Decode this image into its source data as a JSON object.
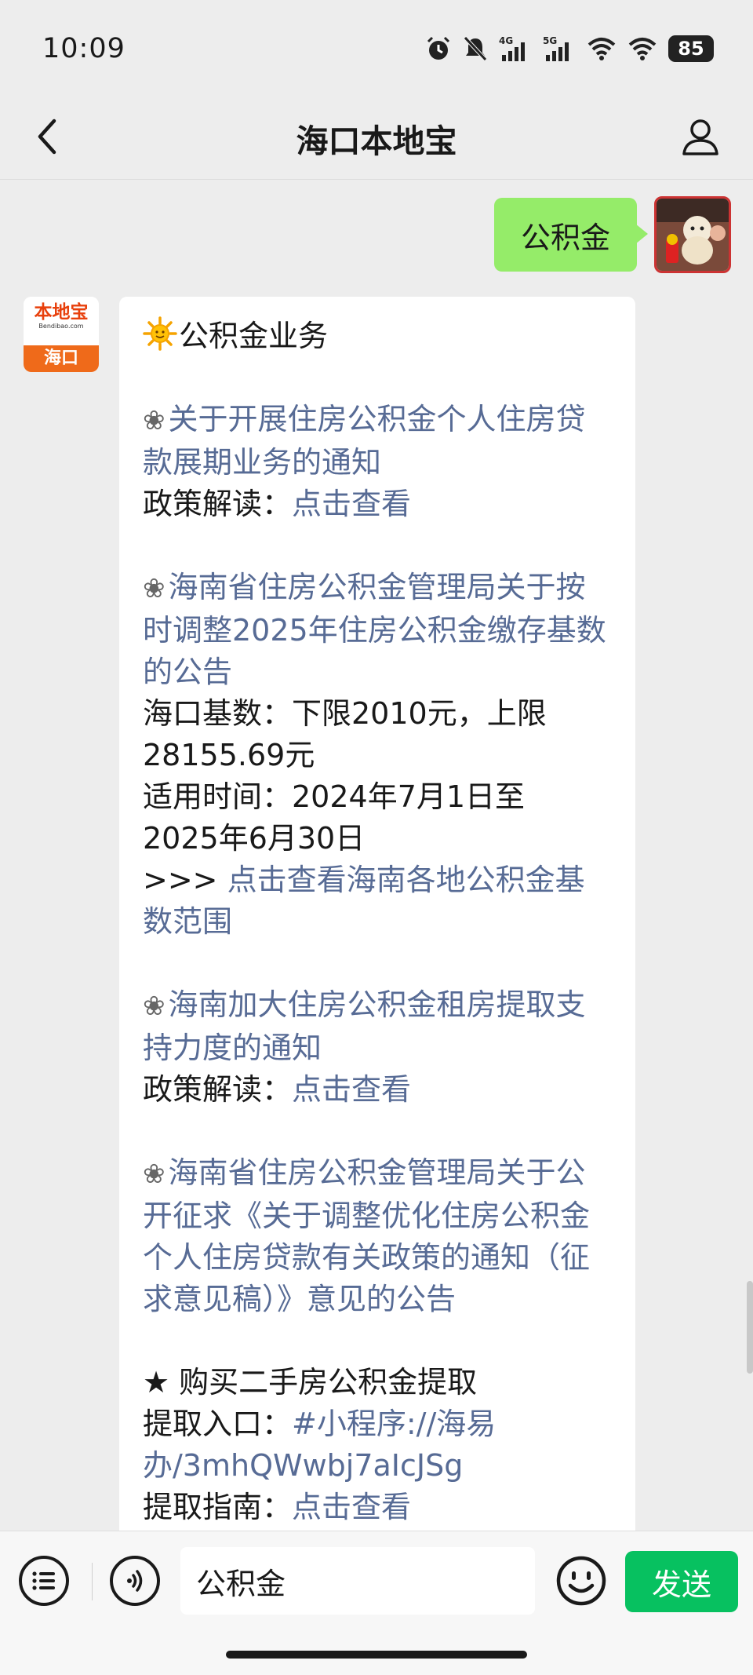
{
  "status_bar": {
    "time": "10:09",
    "battery": "85",
    "signal_labels": [
      "4G",
      "5G"
    ]
  },
  "header": {
    "title": "海口本地宝"
  },
  "chat": {
    "sent_message": "公积金",
    "bot_avatar": {
      "brand": "本地宝",
      "sub": "Bendibao.com",
      "city": "海口"
    },
    "reply": {
      "heading": "公积金业务",
      "item1_title": "关于开展住房公积金个人住房贷款展期业务的通知",
      "item1_policy_label": "政策解读：",
      "item1_policy_link": "点击查看",
      "item2_title": "海南省住房公积金管理局关于按时调整2025年住房公积金缴存基数的公告",
      "item2_base_line1": "海口基数：下限2010元，上限",
      "item2_base_line2": "28155.69元",
      "item2_period_line1": "适用时间：2024年7月1日至",
      "item2_period_line2": "2025年6月30日",
      "item2_more_prefix": ">>>",
      "item2_more_link": "点击查看海南各地公积金基数范围",
      "item3_title": "海南加大住房公积金租房提取支持力度的通知",
      "item3_policy_label": "政策解读：",
      "item3_policy_link": "点击查看",
      "item4_title": "海南省住房公积金管理局关于公开征求《关于调整优化住房公积金个人住房贷款有关政策的通知（征求意见稿）》意见的公告",
      "item5_title": "★ 购买二手房公积金提取",
      "item5_entry_label": "提取入口：",
      "item5_entry_link": "#小程序://海易办/3mhQWwbj7aIcJSg",
      "item5_guide_label": "提取指南：",
      "item5_guide_link": "点击查看"
    }
  },
  "input_bar": {
    "value": "公积金",
    "send_label": "发送"
  },
  "colors": {
    "sent_bubble": "#95ec69",
    "link": "#576b95",
    "send_button": "#07c160",
    "background": "#ededed"
  },
  "icons": [
    "alarm-icon",
    "mute-bell-icon",
    "signal-4g-icon",
    "signal-5g-icon",
    "wifi-icon",
    "back-chevron-icon",
    "profile-icon",
    "menu-list-icon",
    "voice-icon",
    "emoji-icon",
    "sun-emoji-icon",
    "flower-bullet-icon"
  ]
}
